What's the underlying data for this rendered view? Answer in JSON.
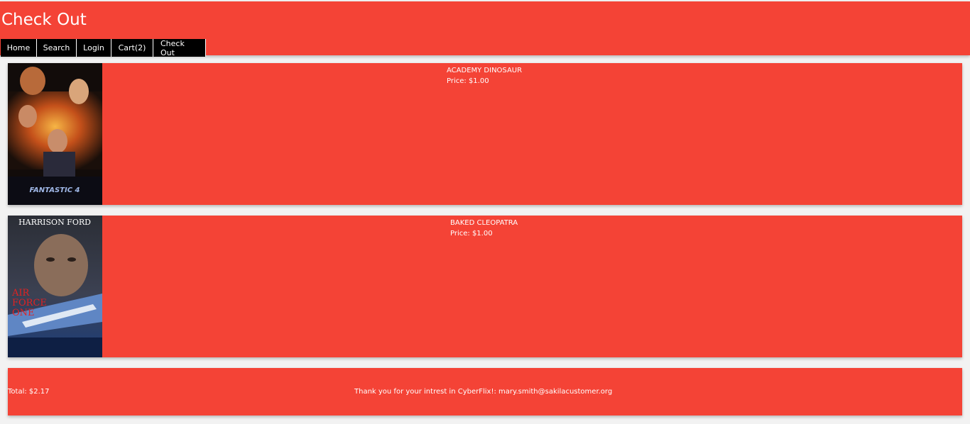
{
  "header": {
    "title": "Check Out",
    "nav": [
      "Home",
      "Search",
      "Login",
      "Cart(2)",
      "Check Out"
    ]
  },
  "cart": {
    "items": [
      {
        "title": "ACADEMY DINOSAUR",
        "price": "Price: $1.00",
        "poster_text": "FANTASTIC 4"
      },
      {
        "title": "BAKED CLEOPATRA",
        "price": "Price: $1.00",
        "poster_text": [
          "HARRISON FORD",
          "AIR",
          "FORCE",
          "ONE"
        ]
      }
    ]
  },
  "footer": {
    "total": "Total: $2.17",
    "thanks": "Thank you for your intrest in CyberFlix!: mary.smith@sakilacustomer.org"
  },
  "colors": {
    "accent": "#f44336",
    "nav_bg": "#000000",
    "text": "#ffffff"
  }
}
